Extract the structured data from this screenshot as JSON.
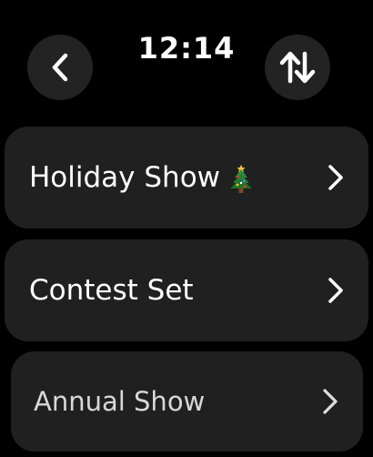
{
  "header": {
    "time": "12:14",
    "back_icon": "chevron-left-icon",
    "sort_icon": "sort-arrows-icon"
  },
  "list": {
    "items": [
      {
        "label": "Holiday Show",
        "emoji": "christmas-tree-icon",
        "chevron": "chevron-right-icon"
      },
      {
        "label": "Contest Set",
        "chevron": "chevron-right-icon"
      },
      {
        "label": "Annual Show",
        "chevron": "chevron-right-icon"
      }
    ]
  },
  "colors": {
    "background": "#000000",
    "button": "#232323",
    "row": "#202020",
    "text": "#ffffff"
  }
}
